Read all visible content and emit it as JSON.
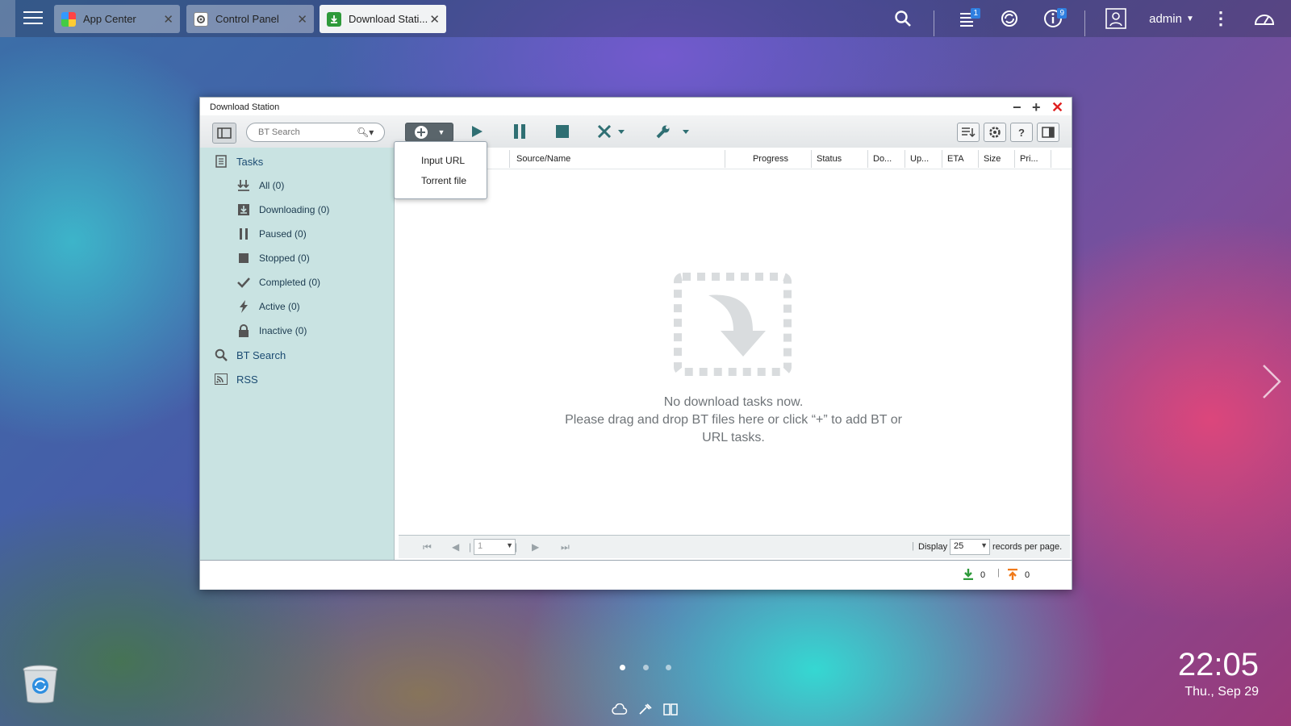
{
  "topbar": {
    "tabs": [
      {
        "label": "App Center",
        "icon": "app-center-icon"
      },
      {
        "label": "Control Panel",
        "icon": "gear-icon"
      },
      {
        "label": "Download Stati...",
        "icon": "download-station-icon"
      }
    ],
    "notifications_badge": "1",
    "info_badge": "9",
    "user": "admin"
  },
  "window": {
    "title": "Download Station",
    "search_placeholder": "BT Search",
    "add_menu": [
      "Input URL",
      "Torrent file"
    ],
    "sidebar": {
      "tasks_label": "Tasks",
      "items": [
        {
          "label": "All (0)",
          "icon": "all-tasks-icon"
        },
        {
          "label": "Downloading (0)",
          "icon": "downloading-icon"
        },
        {
          "label": "Paused (0)",
          "icon": "paused-icon"
        },
        {
          "label": "Stopped (0)",
          "icon": "stopped-icon"
        },
        {
          "label": "Completed (0)",
          "icon": "check-icon"
        },
        {
          "label": "Active (0)",
          "icon": "lightning-icon"
        },
        {
          "label": "Inactive (0)",
          "icon": "lock-icon"
        }
      ],
      "bt_search_label": "BT Search",
      "rss_label": "RSS"
    },
    "columns": [
      "r",
      "Source/Name",
      "Progress",
      "Status",
      "Do...",
      "Up...",
      "ETA",
      "Size",
      "Pri..."
    ],
    "empty_message_line1": "No download tasks now.",
    "empty_message_line2": "Please drag and drop BT files here or click “+” to add BT or URL tasks.",
    "pager": {
      "page": "1",
      "display_label": "Display",
      "per_page": "25",
      "suffix": "records per page."
    },
    "status": {
      "download_count": "0",
      "upload_count": "0"
    }
  },
  "desktop": {
    "time": "22:05",
    "date": "Thu., Sep 29",
    "page_dots": 3,
    "active_dot": 1
  },
  "colors": {
    "accent_blue": "#2f7fe0",
    "sidebar_bg": "#c9e3e2",
    "close_red": "#e02020",
    "download_green": "#2e9a3a",
    "upload_orange": "#f07a1a"
  }
}
